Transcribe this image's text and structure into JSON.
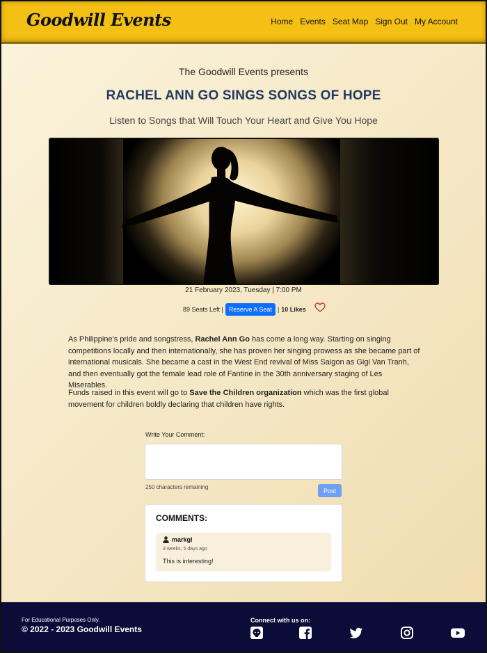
{
  "navbar": {
    "brand": "Goodwill Events",
    "links": [
      "Home",
      "Events",
      "Seat Map",
      "Sign Out",
      "My Account"
    ]
  },
  "event": {
    "presents": "The Goodwill Events presents",
    "title": "RACHEL ANN GO SINGS SONGS OF HOPE",
    "subtitle": "Listen to Songs that Will Touch Your Heart and Give You Hope",
    "datetime": "21 February 2023, Tuesday | 7:00 PM",
    "seats_left": "89 Seats Left |",
    "reserve_label": "Reserve A Seat",
    "likes_sep": "|",
    "likes": "10 Likes",
    "desc_p1_a": "As Philippine's pride and songstress, ",
    "desc_p1_b": "Rachel Ann Go",
    "desc_p1_c": " has come a long way. Starting on singing competitions locally and then internationally, she has proven her singing prowess as she became part of international musicals. She became a cast in the West End revival of Miss Saigon as Gigi Van Tranh, and then eventually got the female lead role of Fantine in the 30th anniversary staging of Les Miserables.",
    "desc_p2_a": "Funds raised in this event will go to ",
    "desc_p2_b": "Save the Children organization",
    "desc_p2_c": " which was the first global movement for children boldly declaring that children have rights."
  },
  "comment_form": {
    "label": "Write Your Comment:",
    "remaining": "250 characters remaining",
    "post_label": "Post"
  },
  "comments": {
    "heading": "COMMENTS:",
    "items": [
      {
        "user": "markgl",
        "time": "3 weeks, 5 days ago",
        "text": "This is interesting!"
      }
    ]
  },
  "footer": {
    "edu": "For Educational Purposes Only.",
    "copyright": "© 2022 - 2023 Goodwill Events",
    "connect": "Connect with us on:",
    "social_icons": [
      "github-icon",
      "facebook-icon",
      "twitter-icon",
      "instagram-icon",
      "youtube-icon"
    ]
  },
  "colors": {
    "navbar": "#f5c014",
    "title": "#243a5e",
    "reserve_button": "#0d6efd",
    "post_button": "#6ea0f3",
    "footer": "#0c0c38",
    "heart": "#c0392b"
  }
}
